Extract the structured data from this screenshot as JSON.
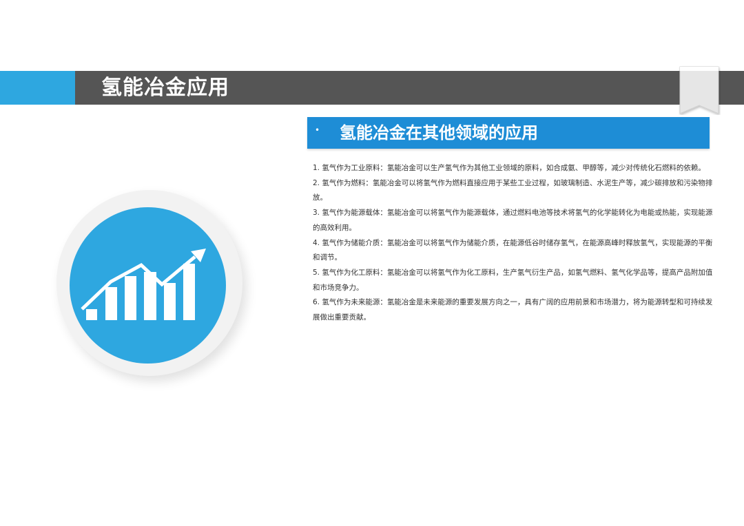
{
  "slide": {
    "title": "氢能冶金应用",
    "section_title": "氢能冶金在其他领域的应用",
    "section_bullet": "•",
    "paragraphs": [
      "1. 氢气作为工业原料：氢能冶金可以生产氢气作为其他工业领域的原料，如合成氨、甲醇等，减少对传统化石燃料的依赖。",
      "2. 氢气作为燃料：氢能冶金可以将氢气作为燃料直接应用于某些工业过程，如玻璃制造、水泥生产等，减少碳排放和污染物排放。",
      "3. 氢气作为能源载体：氢能冶金可以将氢气作为能源载体，通过燃料电池等技术将氢气的化学能转化为电能或热能，实现能源的高效利用。",
      "4. 氢气作为储能介质：氢能冶金可以将氢气作为储能介质，在能源低谷时储存氢气，在能源高峰时释放氢气，实现能源的平衡和调节。",
      "5. 氢气作为化工原料：氢能冶金可以将氢气作为化工原料，生产氢气衍生产品，如氢气燃料、氢气化学品等，提高产品附加值和市场竞争力。",
      "6. 氢气作为未来能源：氢能冶金是未来能源的重要发展方向之一，具有广阔的应用前景和市场潜力，将为能源转型和可持续发展做出重要贡献。"
    ]
  },
  "icons": {
    "illustration": "growth-chart-icon",
    "corner": "bookmark-icon"
  },
  "colors": {
    "title_bar": "#555555",
    "accent_blue": "#2ea7e0",
    "section_blue": "#1e8dd6",
    "body_text": "#333333"
  }
}
